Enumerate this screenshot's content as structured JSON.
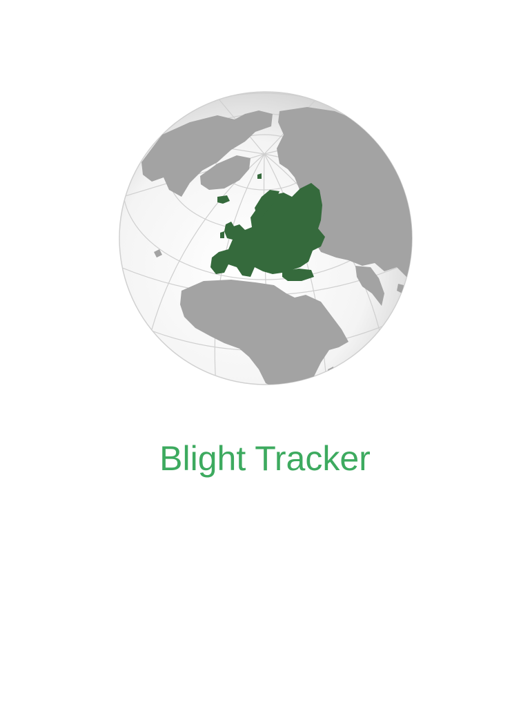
{
  "splash": {
    "app_title": "Blight Tracker",
    "logo_icon": "globe-europe-highlighted-icon",
    "colors": {
      "title": "#3daa5f",
      "europe": "#356a3c",
      "land": "#a3a3a3",
      "ocean_light": "#ffffff",
      "ocean_shade": "#dcdcdc",
      "graticule": "#cfcfcf"
    }
  }
}
